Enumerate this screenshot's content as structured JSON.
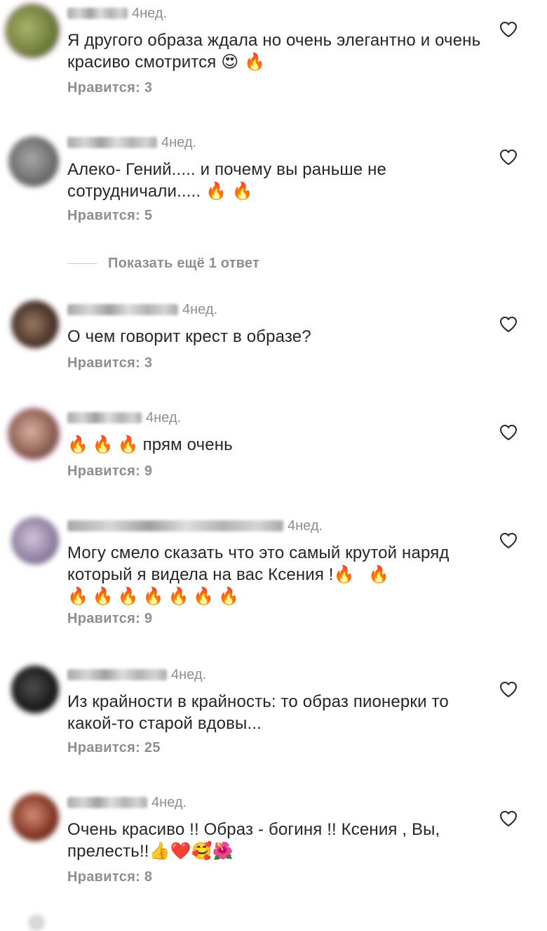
{
  "comments": [
    {
      "username_placeholder": "blurred username",
      "time": "4нед.",
      "text": "Я другого образа ждала но очень элегантно и очень красиво смотрится",
      "emoji": "😍 🔥",
      "likes": "Нравится: 3",
      "avatar_colors": [
        "#6e7d3b",
        "#a9b36a"
      ]
    },
    {
      "username_placeholder": "blurred username",
      "time": "4нед.",
      "text": "Алеко- Гений..... и почему вы раньше не сотрудничали.....",
      "emoji": "🔥 🔥",
      "likes": "Нравится: 5",
      "avatar_colors": [
        "#6b6b6b",
        "#a8a8a8"
      ]
    },
    {
      "username_placeholder": "blurred username",
      "time": "4нед.",
      "text": "О чем говорит крест в образе?",
      "emoji": "",
      "likes": "Нравится: 3",
      "avatar_colors": [
        "#4a3328",
        "#9b7a64"
      ]
    },
    {
      "username_placeholder": "blurred username",
      "time": "4нед.",
      "text": "прям очень",
      "emoji": "🔥🔥🔥",
      "likes": "Нравится: 9",
      "avatar_colors": [
        "#8a5d4e",
        "#d7b1a2"
      ]
    },
    {
      "username_placeholder": "blurred username",
      "time": "4нед.",
      "text": "Могу смело сказать что это самый крутой наряд который я видела на вас Ксения !",
      "emoji": "🔥 🔥",
      "emoji_line2": "🔥🔥🔥🔥🔥🔥🔥",
      "likes": "Нравится: 9",
      "avatar_colors": [
        "#8d7f9e",
        "#d2c4dd"
      ]
    },
    {
      "username_placeholder": "blurred username",
      "time": "4нед.",
      "text": "Из крайности в крайность: то образ пионерки то какой-то старой вдовы...",
      "emoji": "",
      "likes": "Нравится: 25",
      "avatar_colors": [
        "#191919",
        "#4e4e4e"
      ]
    },
    {
      "username_placeholder": "blurred username",
      "time": "4нед.",
      "text": "Очень красиво !! Образ - богиня !! Ксения , Вы, прелесть!!",
      "emoji": "👍❤️🥰🌺",
      "likes": "Нравится: 8",
      "avatar_colors": [
        "#7f3323",
        "#d38c75"
      ]
    }
  ],
  "replies_toggle": {
    "label": "Показать ещё 1 ответ"
  },
  "colors": {
    "text": "#262626",
    "secondary": "#8e8e8e",
    "background": "#ffffff",
    "divider": "#c7c7c7"
  },
  "icons": {
    "like": "heart-outline-icon"
  }
}
